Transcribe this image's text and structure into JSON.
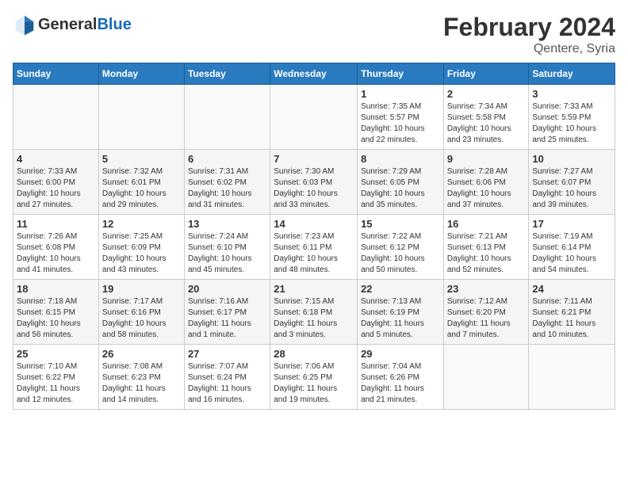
{
  "header": {
    "logo_general": "General",
    "logo_blue": "Blue",
    "title": "February 2024",
    "subtitle": "Qentere, Syria"
  },
  "weekdays": [
    "Sunday",
    "Monday",
    "Tuesday",
    "Wednesday",
    "Thursday",
    "Friday",
    "Saturday"
  ],
  "weeks": [
    [
      {
        "day": "",
        "info": ""
      },
      {
        "day": "",
        "info": ""
      },
      {
        "day": "",
        "info": ""
      },
      {
        "day": "",
        "info": ""
      },
      {
        "day": "1",
        "info": "Sunrise: 7:35 AM\nSunset: 5:57 PM\nDaylight: 10 hours\nand 22 minutes."
      },
      {
        "day": "2",
        "info": "Sunrise: 7:34 AM\nSunset: 5:58 PM\nDaylight: 10 hours\nand 23 minutes."
      },
      {
        "day": "3",
        "info": "Sunrise: 7:33 AM\nSunset: 5:59 PM\nDaylight: 10 hours\nand 25 minutes."
      }
    ],
    [
      {
        "day": "4",
        "info": "Sunrise: 7:33 AM\nSunset: 6:00 PM\nDaylight: 10 hours\nand 27 minutes."
      },
      {
        "day": "5",
        "info": "Sunrise: 7:32 AM\nSunset: 6:01 PM\nDaylight: 10 hours\nand 29 minutes."
      },
      {
        "day": "6",
        "info": "Sunrise: 7:31 AM\nSunset: 6:02 PM\nDaylight: 10 hours\nand 31 minutes."
      },
      {
        "day": "7",
        "info": "Sunrise: 7:30 AM\nSunset: 6:03 PM\nDaylight: 10 hours\nand 33 minutes."
      },
      {
        "day": "8",
        "info": "Sunrise: 7:29 AM\nSunset: 6:05 PM\nDaylight: 10 hours\nand 35 minutes."
      },
      {
        "day": "9",
        "info": "Sunrise: 7:28 AM\nSunset: 6:06 PM\nDaylight: 10 hours\nand 37 minutes."
      },
      {
        "day": "10",
        "info": "Sunrise: 7:27 AM\nSunset: 6:07 PM\nDaylight: 10 hours\nand 39 minutes."
      }
    ],
    [
      {
        "day": "11",
        "info": "Sunrise: 7:26 AM\nSunset: 6:08 PM\nDaylight: 10 hours\nand 41 minutes."
      },
      {
        "day": "12",
        "info": "Sunrise: 7:25 AM\nSunset: 6:09 PM\nDaylight: 10 hours\nand 43 minutes."
      },
      {
        "day": "13",
        "info": "Sunrise: 7:24 AM\nSunset: 6:10 PM\nDaylight: 10 hours\nand 45 minutes."
      },
      {
        "day": "14",
        "info": "Sunrise: 7:23 AM\nSunset: 6:11 PM\nDaylight: 10 hours\nand 48 minutes."
      },
      {
        "day": "15",
        "info": "Sunrise: 7:22 AM\nSunset: 6:12 PM\nDaylight: 10 hours\nand 50 minutes."
      },
      {
        "day": "16",
        "info": "Sunrise: 7:21 AM\nSunset: 6:13 PM\nDaylight: 10 hours\nand 52 minutes."
      },
      {
        "day": "17",
        "info": "Sunrise: 7:19 AM\nSunset: 6:14 PM\nDaylight: 10 hours\nand 54 minutes."
      }
    ],
    [
      {
        "day": "18",
        "info": "Sunrise: 7:18 AM\nSunset: 6:15 PM\nDaylight: 10 hours\nand 56 minutes."
      },
      {
        "day": "19",
        "info": "Sunrise: 7:17 AM\nSunset: 6:16 PM\nDaylight: 10 hours\nand 58 minutes."
      },
      {
        "day": "20",
        "info": "Sunrise: 7:16 AM\nSunset: 6:17 PM\nDaylight: 11 hours\nand 1 minute."
      },
      {
        "day": "21",
        "info": "Sunrise: 7:15 AM\nSunset: 6:18 PM\nDaylight: 11 hours\nand 3 minutes."
      },
      {
        "day": "22",
        "info": "Sunrise: 7:13 AM\nSunset: 6:19 PM\nDaylight: 11 hours\nand 5 minutes."
      },
      {
        "day": "23",
        "info": "Sunrise: 7:12 AM\nSunset: 6:20 PM\nDaylight: 11 hours\nand 7 minutes."
      },
      {
        "day": "24",
        "info": "Sunrise: 7:11 AM\nSunset: 6:21 PM\nDaylight: 11 hours\nand 10 minutes."
      }
    ],
    [
      {
        "day": "25",
        "info": "Sunrise: 7:10 AM\nSunset: 6:22 PM\nDaylight: 11 hours\nand 12 minutes."
      },
      {
        "day": "26",
        "info": "Sunrise: 7:08 AM\nSunset: 6:23 PM\nDaylight: 11 hours\nand 14 minutes."
      },
      {
        "day": "27",
        "info": "Sunrise: 7:07 AM\nSunset: 6:24 PM\nDaylight: 11 hours\nand 16 minutes."
      },
      {
        "day": "28",
        "info": "Sunrise: 7:06 AM\nSunset: 6:25 PM\nDaylight: 11 hours\nand 19 minutes."
      },
      {
        "day": "29",
        "info": "Sunrise: 7:04 AM\nSunset: 6:26 PM\nDaylight: 11 hours\nand 21 minutes."
      },
      {
        "day": "",
        "info": ""
      },
      {
        "day": "",
        "info": ""
      }
    ]
  ]
}
